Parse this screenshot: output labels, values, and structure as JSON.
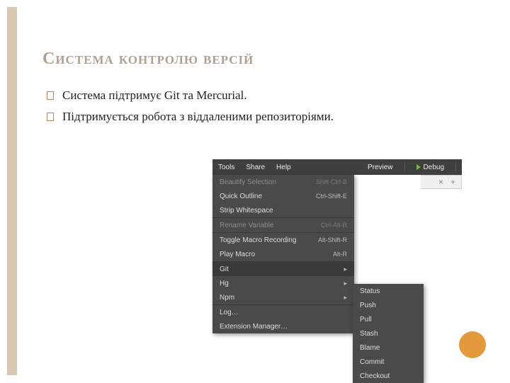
{
  "title": "Система контролю версій",
  "bullets": [
    "Система підтримує Git та Mercurial.",
    "Підтримується робота з віддаленими репозиторіями."
  ],
  "menubar": {
    "tools": "Tools",
    "share": "Share",
    "help": "Help",
    "preview": "Preview",
    "debug": "Debug"
  },
  "tabstrip": {
    "close": "×",
    "add": "+"
  },
  "menu": {
    "beautify": {
      "label": "Beautify Selection",
      "shortcut": "Shift-Ctrl-B"
    },
    "quickoutline": {
      "label": "Quick Outline",
      "shortcut": "Ctrl-Shift-E"
    },
    "strip": {
      "label": "Strip Whitespace",
      "shortcut": ""
    },
    "rename": {
      "label": "Rename Variable",
      "shortcut": "Ctrl-Alt-R"
    },
    "togglemacro": {
      "label": "Toggle Macro Recording",
      "shortcut": "Alt-Shift-R"
    },
    "playmacro": {
      "label": "Play Macro",
      "shortcut": "Alt-R"
    },
    "git": {
      "label": "Git"
    },
    "hg": {
      "label": "Hg"
    },
    "npm": {
      "label": "Npm"
    },
    "log": {
      "label": "Log…"
    },
    "extmgr": {
      "label": "Extension Manager…"
    }
  },
  "submenu": {
    "status": "Status",
    "push": "Push",
    "pull": "Pull",
    "stash": "Stash",
    "blame": "Blame",
    "commit": "Commit",
    "checkout": "Checkout"
  }
}
